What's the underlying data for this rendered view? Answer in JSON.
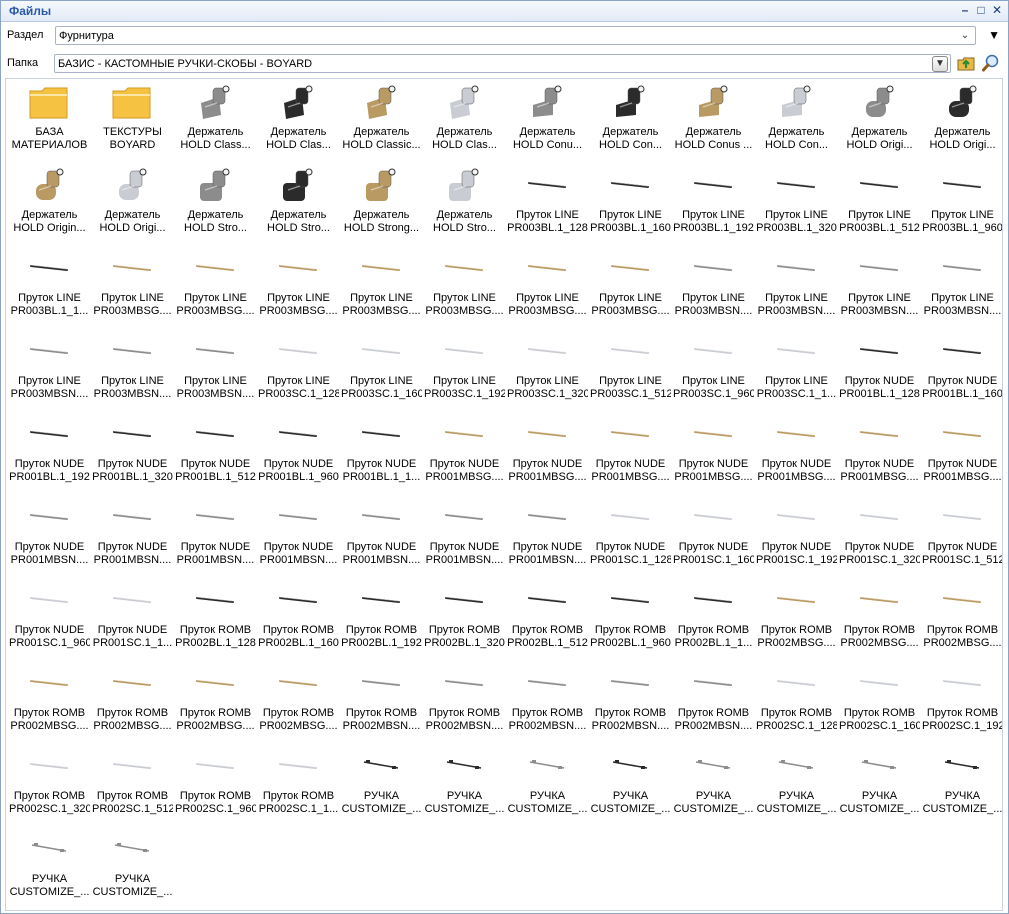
{
  "window": {
    "title": "Файлы",
    "min_glyph": "–",
    "restore_glyph": "□",
    "close_glyph": "✕"
  },
  "section": {
    "label": "Раздел",
    "value": "Фурнитура"
  },
  "folder": {
    "label": "Папка",
    "value": "БАЗИС - КАСТОМНЫЕ РУЧКИ-СКОБЫ - BOYARD"
  },
  "colors": {
    "title_text": "#2a5aa8",
    "folder_icon": "#f5c242",
    "finish_chrome": "#c9ccd2",
    "finish_black": "#2b2b2b",
    "finish_gold": "#b89a62",
    "finish_satin": "#8c8c8c"
  },
  "items": [
    {
      "l1": "БАЗА",
      "l2": "МАТЕРИАЛОВ",
      "icon": "folder-icon"
    },
    {
      "l1": "ТЕКСТУРЫ",
      "l2": "BOYARD",
      "icon": "folder-icon"
    },
    {
      "l1": "Держатель",
      "l2": "HOLD Class...",
      "icon": "holder-classic-icon",
      "finish": "satin"
    },
    {
      "l1": "Держатель",
      "l2": "HOLD Clas...",
      "icon": "holder-classic-icon",
      "finish": "black"
    },
    {
      "l1": "Держатель",
      "l2": "HOLD Classic...",
      "icon": "holder-classic-icon",
      "finish": "gold"
    },
    {
      "l1": "Держатель",
      "l2": "HOLD Clas...",
      "icon": "holder-classic-icon",
      "finish": "chrome"
    },
    {
      "l1": "Держатель",
      "l2": "HOLD Conu...",
      "icon": "holder-conus-icon",
      "finish": "satin"
    },
    {
      "l1": "Держатель",
      "l2": "HOLD Con...",
      "icon": "holder-conus-icon",
      "finish": "black"
    },
    {
      "l1": "Держатель",
      "l2": "HOLD Conus ...",
      "icon": "holder-conus-icon",
      "finish": "gold"
    },
    {
      "l1": "Держатель",
      "l2": "HOLD Con...",
      "icon": "holder-conus-icon",
      "finish": "chrome"
    },
    {
      "l1": "Держатель",
      "l2": "HOLD Origi...",
      "icon": "holder-original-icon",
      "finish": "satin"
    },
    {
      "l1": "Держатель",
      "l2": "HOLD Origi...",
      "icon": "holder-original-icon",
      "finish": "black"
    },
    {
      "l1": "Держатель",
      "l2": "HOLD Origin...",
      "icon": "holder-original-icon",
      "finish": "gold"
    },
    {
      "l1": "Держатель",
      "l2": "HOLD Origi...",
      "icon": "holder-original-icon",
      "finish": "chrome"
    },
    {
      "l1": "Держатель",
      "l2": "HOLD Stro...",
      "icon": "holder-strong-icon",
      "finish": "satin"
    },
    {
      "l1": "Держатель",
      "l2": "HOLD Stro...",
      "icon": "holder-strong-icon",
      "finish": "black"
    },
    {
      "l1": "Держатель",
      "l2": "HOLD Strong...",
      "icon": "holder-strong-icon",
      "finish": "gold"
    },
    {
      "l1": "Держатель",
      "l2": "HOLD Stro...",
      "icon": "holder-strong-icon",
      "finish": "chrome"
    },
    {
      "l1": "Пруток LINE",
      "l2": "PR003BL.1_128",
      "icon": "rod-icon",
      "finish": "black"
    },
    {
      "l1": "Пруток LINE",
      "l2": "PR003BL.1_160",
      "icon": "rod-icon",
      "finish": "black"
    },
    {
      "l1": "Пруток LINE",
      "l2": "PR003BL.1_192",
      "icon": "rod-icon",
      "finish": "black"
    },
    {
      "l1": "Пруток LINE",
      "l2": "PR003BL.1_320",
      "icon": "rod-icon",
      "finish": "black"
    },
    {
      "l1": "Пруток LINE",
      "l2": "PR003BL.1_512",
      "icon": "rod-icon",
      "finish": "black"
    },
    {
      "l1": "Пруток LINE",
      "l2": "PR003BL.1_960",
      "icon": "rod-icon",
      "finish": "black"
    },
    {
      "l1": "Пруток LINE",
      "l2": "PR003BL.1_1...",
      "icon": "rod-icon",
      "finish": "black"
    },
    {
      "l1": "Пруток LINE",
      "l2": "PR003MBSG....",
      "icon": "rod-icon",
      "finish": "gold"
    },
    {
      "l1": "Пруток LINE",
      "l2": "PR003MBSG....",
      "icon": "rod-icon",
      "finish": "gold"
    },
    {
      "l1": "Пруток LINE",
      "l2": "PR003MBSG....",
      "icon": "rod-icon",
      "finish": "gold"
    },
    {
      "l1": "Пруток LINE",
      "l2": "PR003MBSG....",
      "icon": "rod-icon",
      "finish": "gold"
    },
    {
      "l1": "Пруток LINE",
      "l2": "PR003MBSG....",
      "icon": "rod-icon",
      "finish": "gold"
    },
    {
      "l1": "Пруток LINE",
      "l2": "PR003MBSG....",
      "icon": "rod-icon",
      "finish": "gold"
    },
    {
      "l1": "Пруток LINE",
      "l2": "PR003MBSG....",
      "icon": "rod-icon",
      "finish": "gold"
    },
    {
      "l1": "Пруток LINE",
      "l2": "PR003MBSN....",
      "icon": "rod-icon",
      "finish": "satin"
    },
    {
      "l1": "Пруток LINE",
      "l2": "PR003MBSN....",
      "icon": "rod-icon",
      "finish": "satin"
    },
    {
      "l1": "Пруток LINE",
      "l2": "PR003MBSN....",
      "icon": "rod-icon",
      "finish": "satin"
    },
    {
      "l1": "Пруток LINE",
      "l2": "PR003MBSN....",
      "icon": "rod-icon",
      "finish": "satin"
    },
    {
      "l1": "Пруток LINE",
      "l2": "PR003MBSN....",
      "icon": "rod-icon",
      "finish": "satin"
    },
    {
      "l1": "Пруток LINE",
      "l2": "PR003MBSN....",
      "icon": "rod-icon",
      "finish": "satin"
    },
    {
      "l1": "Пруток LINE",
      "l2": "PR003MBSN....",
      "icon": "rod-icon",
      "finish": "satin"
    },
    {
      "l1": "Пруток LINE",
      "l2": "PR003SC.1_128",
      "icon": "rod-icon",
      "finish": "chrome"
    },
    {
      "l1": "Пруток LINE",
      "l2": "PR003SC.1_160",
      "icon": "rod-icon",
      "finish": "chrome"
    },
    {
      "l1": "Пруток LINE",
      "l2": "PR003SC.1_192",
      "icon": "rod-icon",
      "finish": "chrome"
    },
    {
      "l1": "Пруток LINE",
      "l2": "PR003SC.1_320",
      "icon": "rod-icon",
      "finish": "chrome"
    },
    {
      "l1": "Пруток LINE",
      "l2": "PR003SC.1_512",
      "icon": "rod-icon",
      "finish": "chrome"
    },
    {
      "l1": "Пруток LINE",
      "l2": "PR003SC.1_960",
      "icon": "rod-icon",
      "finish": "chrome"
    },
    {
      "l1": "Пруток LINE",
      "l2": "PR003SC.1_1...",
      "icon": "rod-icon",
      "finish": "chrome"
    },
    {
      "l1": "Пруток NUDE",
      "l2": "PR001BL.1_128",
      "icon": "rod-icon",
      "finish": "black"
    },
    {
      "l1": "Пруток NUDE",
      "l2": "PR001BL.1_160",
      "icon": "rod-icon",
      "finish": "black"
    },
    {
      "l1": "Пруток NUDE",
      "l2": "PR001BL.1_192",
      "icon": "rod-icon",
      "finish": "black"
    },
    {
      "l1": "Пруток NUDE",
      "l2": "PR001BL.1_320",
      "icon": "rod-icon",
      "finish": "black"
    },
    {
      "l1": "Пруток NUDE",
      "l2": "PR001BL.1_512",
      "icon": "rod-icon",
      "finish": "black"
    },
    {
      "l1": "Пруток NUDE",
      "l2": "PR001BL.1_960",
      "icon": "rod-icon",
      "finish": "black"
    },
    {
      "l1": "Пруток NUDE",
      "l2": "PR001BL.1_1...",
      "icon": "rod-icon",
      "finish": "black"
    },
    {
      "l1": "Пруток NUDE",
      "l2": "PR001MBSG....",
      "icon": "rod-icon",
      "finish": "gold"
    },
    {
      "l1": "Пруток NUDE",
      "l2": "PR001MBSG....",
      "icon": "rod-icon",
      "finish": "gold"
    },
    {
      "l1": "Пруток NUDE",
      "l2": "PR001MBSG....",
      "icon": "rod-icon",
      "finish": "gold"
    },
    {
      "l1": "Пруток NUDE",
      "l2": "PR001MBSG....",
      "icon": "rod-icon",
      "finish": "gold"
    },
    {
      "l1": "Пруток NUDE",
      "l2": "PR001MBSG....",
      "icon": "rod-icon",
      "finish": "gold"
    },
    {
      "l1": "Пруток NUDE",
      "l2": "PR001MBSG....",
      "icon": "rod-icon",
      "finish": "gold"
    },
    {
      "l1": "Пруток NUDE",
      "l2": "PR001MBSG....",
      "icon": "rod-icon",
      "finish": "gold"
    },
    {
      "l1": "Пруток NUDE",
      "l2": "PR001MBSN....",
      "icon": "rod-icon",
      "finish": "satin"
    },
    {
      "l1": "Пруток NUDE",
      "l2": "PR001MBSN....",
      "icon": "rod-icon",
      "finish": "satin"
    },
    {
      "l1": "Пруток NUDE",
      "l2": "PR001MBSN....",
      "icon": "rod-icon",
      "finish": "satin"
    },
    {
      "l1": "Пруток NUDE",
      "l2": "PR001MBSN....",
      "icon": "rod-icon",
      "finish": "satin"
    },
    {
      "l1": "Пруток NUDE",
      "l2": "PR001MBSN....",
      "icon": "rod-icon",
      "finish": "satin"
    },
    {
      "l1": "Пруток NUDE",
      "l2": "PR001MBSN....",
      "icon": "rod-icon",
      "finish": "satin"
    },
    {
      "l1": "Пруток NUDE",
      "l2": "PR001MBSN....",
      "icon": "rod-icon",
      "finish": "satin"
    },
    {
      "l1": "Пруток NUDE",
      "l2": "PR001SC.1_128",
      "icon": "rod-icon",
      "finish": "chrome"
    },
    {
      "l1": "Пруток NUDE",
      "l2": "PR001SC.1_160",
      "icon": "rod-icon",
      "finish": "chrome"
    },
    {
      "l1": "Пруток NUDE",
      "l2": "PR001SC.1_192",
      "icon": "rod-icon",
      "finish": "chrome"
    },
    {
      "l1": "Пруток NUDE",
      "l2": "PR001SC.1_320",
      "icon": "rod-icon",
      "finish": "chrome"
    },
    {
      "l1": "Пруток NUDE",
      "l2": "PR001SC.1_512",
      "icon": "rod-icon",
      "finish": "chrome"
    },
    {
      "l1": "Пруток NUDE",
      "l2": "PR001SC.1_960",
      "icon": "rod-icon",
      "finish": "chrome"
    },
    {
      "l1": "Пруток NUDE",
      "l2": "PR001SC.1_1...",
      "icon": "rod-icon",
      "finish": "chrome"
    },
    {
      "l1": "Пруток ROMB",
      "l2": "PR002BL.1_128",
      "icon": "rod-icon",
      "finish": "black"
    },
    {
      "l1": "Пруток ROMB",
      "l2": "PR002BL.1_160",
      "icon": "rod-icon",
      "finish": "black"
    },
    {
      "l1": "Пруток ROMB",
      "l2": "PR002BL.1_192",
      "icon": "rod-icon",
      "finish": "black"
    },
    {
      "l1": "Пруток ROMB",
      "l2": "PR002BL.1_320",
      "icon": "rod-icon",
      "finish": "black"
    },
    {
      "l1": "Пруток ROMB",
      "l2": "PR002BL.1_512",
      "icon": "rod-icon",
      "finish": "black"
    },
    {
      "l1": "Пруток ROMB",
      "l2": "PR002BL.1_960",
      "icon": "rod-icon",
      "finish": "black"
    },
    {
      "l1": "Пруток ROMB",
      "l2": "PR002BL.1_1...",
      "icon": "rod-icon",
      "finish": "black"
    },
    {
      "l1": "Пруток ROMB",
      "l2": "PR002MBSG....",
      "icon": "rod-icon",
      "finish": "gold"
    },
    {
      "l1": "Пруток ROMB",
      "l2": "PR002MBSG....",
      "icon": "rod-icon",
      "finish": "gold"
    },
    {
      "l1": "Пруток ROMB",
      "l2": "PR002MBSG....",
      "icon": "rod-icon",
      "finish": "gold"
    },
    {
      "l1": "Пруток ROMB",
      "l2": "PR002MBSG....",
      "icon": "rod-icon",
      "finish": "gold"
    },
    {
      "l1": "Пруток ROMB",
      "l2": "PR002MBSG....",
      "icon": "rod-icon",
      "finish": "gold"
    },
    {
      "l1": "Пруток ROMB",
      "l2": "PR002MBSG....",
      "icon": "rod-icon",
      "finish": "gold"
    },
    {
      "l1": "Пруток ROMB",
      "l2": "PR002MBSG....",
      "icon": "rod-icon",
      "finish": "gold"
    },
    {
      "l1": "Пруток ROMB",
      "l2": "PR002MBSN....",
      "icon": "rod-icon",
      "finish": "satin"
    },
    {
      "l1": "Пруток ROMB",
      "l2": "PR002MBSN....",
      "icon": "rod-icon",
      "finish": "satin"
    },
    {
      "l1": "Пруток ROMB",
      "l2": "PR002MBSN....",
      "icon": "rod-icon",
      "finish": "satin"
    },
    {
      "l1": "Пруток ROMB",
      "l2": "PR002MBSN....",
      "icon": "rod-icon",
      "finish": "satin"
    },
    {
      "l1": "Пруток ROMB",
      "l2": "PR002MBSN....",
      "icon": "rod-icon",
      "finish": "satin"
    },
    {
      "l1": "Пруток ROMB",
      "l2": "PR002SC.1_128",
      "icon": "rod-icon",
      "finish": "chrome"
    },
    {
      "l1": "Пруток ROMB",
      "l2": "PR002SC.1_160",
      "icon": "rod-icon",
      "finish": "chrome"
    },
    {
      "l1": "Пруток ROMB",
      "l2": "PR002SC.1_192",
      "icon": "rod-icon",
      "finish": "chrome"
    },
    {
      "l1": "Пруток ROMB",
      "l2": "PR002SC.1_320",
      "icon": "rod-icon",
      "finish": "chrome"
    },
    {
      "l1": "Пруток ROMB",
      "l2": "PR002SC.1_512",
      "icon": "rod-icon",
      "finish": "chrome"
    },
    {
      "l1": "Пруток ROMB",
      "l2": "PR002SC.1_960",
      "icon": "rod-icon",
      "finish": "chrome"
    },
    {
      "l1": "Пруток ROMB",
      "l2": "PR002SC.1_1...",
      "icon": "rod-icon",
      "finish": "chrome"
    },
    {
      "l1": "РУЧКА",
      "l2": "CUSTOMIZE_...",
      "icon": "handle-custom-icon",
      "finish": "black"
    },
    {
      "l1": "РУЧКА",
      "l2": "CUSTOMIZE_...",
      "icon": "handle-custom-icon",
      "finish": "black"
    },
    {
      "l1": "РУЧКА",
      "l2": "CUSTOMIZE_...",
      "icon": "handle-custom-icon",
      "finish": "satin"
    },
    {
      "l1": "РУЧКА",
      "l2": "CUSTOMIZE_...",
      "icon": "handle-custom-icon",
      "finish": "black"
    },
    {
      "l1": "РУЧКА",
      "l2": "CUSTOMIZE_...",
      "icon": "handle-custom-icon",
      "finish": "satin"
    },
    {
      "l1": "РУЧКА",
      "l2": "CUSTOMIZE_...",
      "icon": "handle-custom-icon",
      "finish": "satin"
    },
    {
      "l1": "РУЧКА",
      "l2": "CUSTOMIZE_...",
      "icon": "handle-custom-icon",
      "finish": "satin"
    },
    {
      "l1": "РУЧКА",
      "l2": "CUSTOMIZE_...",
      "icon": "handle-custom-icon",
      "finish": "black"
    },
    {
      "l1": "РУЧКА",
      "l2": "CUSTOMIZE_...",
      "icon": "handle-custom-icon",
      "finish": "satin"
    },
    {
      "l1": "РУЧКА",
      "l2": "CUSTOMIZE_...",
      "icon": "handle-custom-icon",
      "finish": "satin"
    }
  ]
}
